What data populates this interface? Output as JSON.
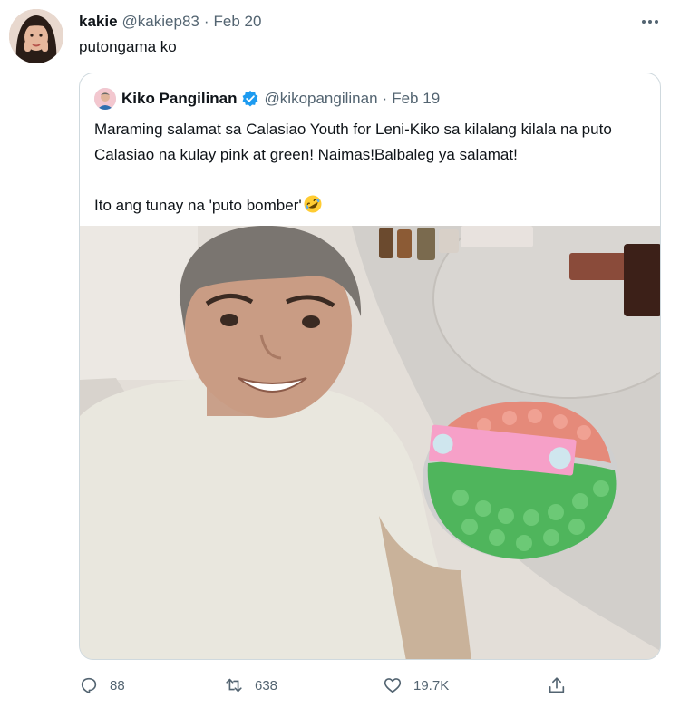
{
  "tweet": {
    "author": {
      "display_name": "kakie",
      "handle": "@kakiep83"
    },
    "separator": "·",
    "date": "Feb 20",
    "text": "putongama ko"
  },
  "quoted_tweet": {
    "author": {
      "display_name": "Kiko Pangilinan",
      "handle": "@kikopangilinan",
      "verified": true
    },
    "separator": "·",
    "date": "Feb 19",
    "text_line_1": "Maraming salamat sa Calasiao Youth for Leni-Kiko sa kilalang kilala na puto Calasiao na kulay pink at green! Naimas!Balbaleg ya salamat!",
    "text_line_2": "Ito ang tunay na 'puto bomber'",
    "emoji": "rolling-on-floor-laughing-emoji"
  },
  "actions": {
    "replies": "88",
    "retweets": "638",
    "likes": "19.7K"
  },
  "colors": {
    "text_primary": "#0f1419",
    "text_secondary": "#536471",
    "border": "#cfd9de",
    "verified": "#1d9bf0"
  }
}
